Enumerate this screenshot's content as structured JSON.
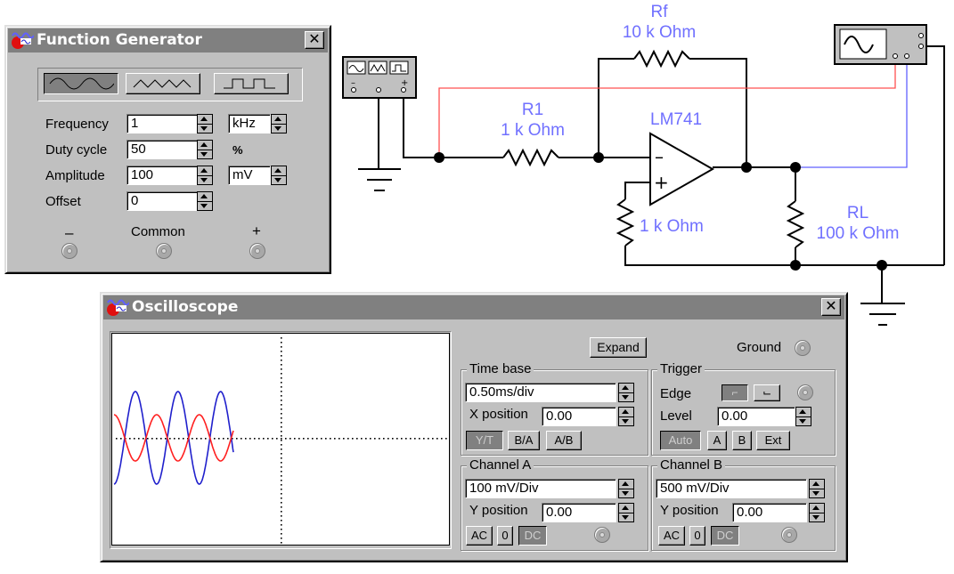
{
  "function_generator": {
    "title": "Function Generator",
    "waveforms": [
      "sine",
      "triangle",
      "square"
    ],
    "frequency_label": "Frequency",
    "frequency_value": "1",
    "frequency_unit": "kHz",
    "duty_cycle_label": "Duty cycle",
    "duty_cycle_value": "50",
    "duty_cycle_unit": "%",
    "amplitude_label": "Amplitude",
    "amplitude_value": "100",
    "amplitude_unit": "mV",
    "offset_label": "Offset",
    "offset_value": "0",
    "minus_label": "–",
    "common_label": "Common",
    "plus_label": "+"
  },
  "circuit": {
    "rf_name": "Rf",
    "rf_value": "10 k Ohm",
    "r1_name": "R1",
    "r1_value": "1 k Ohm",
    "opamp": "LM741",
    "opamp_minus": "–",
    "opamp_plus": "+",
    "r2_value": "1 k Ohm",
    "rl_name": "RL",
    "rl_value": "100 k Ohm",
    "gen_terminals": [
      "–",
      "+"
    ],
    "colors": {
      "channel_a_wire": "#ff4040",
      "channel_b_wire": "#6060ff",
      "label": "#7070ff"
    }
  },
  "oscilloscope": {
    "title": "Oscilloscope",
    "expand_label": "Expand",
    "ground_label": "Ground",
    "time_base": {
      "group_label": "Time base",
      "value": "0.50ms/div",
      "x_position_label": "X position",
      "x_position_value": "0.00",
      "modes": [
        "Y/T",
        "B/A",
        "A/B"
      ],
      "active_mode": "Y/T"
    },
    "trigger": {
      "group_label": "Trigger",
      "edge_label": "Edge",
      "level_label": "Level",
      "level_value": "0.00",
      "sources": [
        "Auto",
        "A",
        "B",
        "Ext"
      ],
      "active_source": "Auto"
    },
    "channel_a": {
      "group_label": "Channel A",
      "scale": "100 mV/Div",
      "y_position_label": "Y position",
      "y_position_value": "0.00",
      "coupling": [
        "AC",
        "0",
        "DC"
      ],
      "active_coupling": "DC"
    },
    "channel_b": {
      "group_label": "Channel B",
      "scale": "500 mV/Div",
      "y_position_label": "Y position",
      "y_position_value": "0.00",
      "coupling": [
        "AC",
        "0",
        "DC"
      ],
      "active_coupling": "DC"
    },
    "traces": {
      "channel_a": {
        "color": "#ff2020",
        "amplitude_div": 1.0,
        "cycles_shown": 2.8
      },
      "channel_b": {
        "color": "#2020cc",
        "amplitude_div": 2.0,
        "cycles_shown": 2.8
      }
    }
  }
}
